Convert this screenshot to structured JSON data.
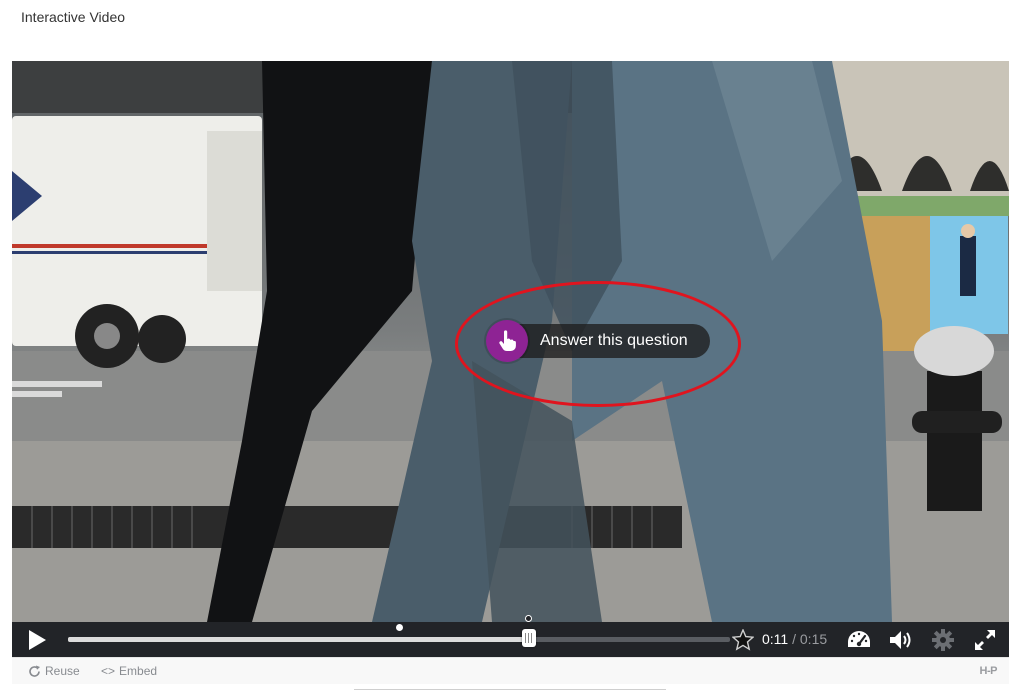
{
  "page": {
    "title": "Interactive Video"
  },
  "player": {
    "hotspot_label": "Answer this question",
    "current_time": "0:11",
    "time_separator": "/",
    "total_time": "0:15",
    "progress_fraction": 0.696,
    "interaction_marker_fraction": 0.5,
    "accent_color": "#8e2394",
    "annotation_color": "#e0141e",
    "icons": [
      "play-icon",
      "star-icon",
      "speed-gauge-icon",
      "volume-icon",
      "gear-icon",
      "fullscreen-icon",
      "hand-pointer-icon"
    ]
  },
  "footer": {
    "reuse_label": "Reuse",
    "embed_label": "Embed",
    "brand": "H-P"
  }
}
